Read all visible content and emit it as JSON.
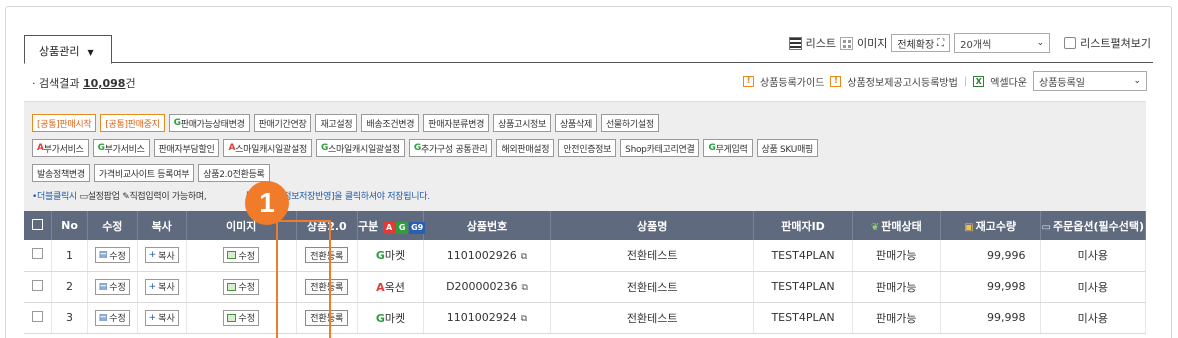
{
  "tab": {
    "label": "상품관리"
  },
  "view": {
    "list_label": "리스트",
    "image_label": "이미지",
    "expand_label": "전체확장",
    "per_page": "20개씩",
    "list_expand_label": "리스트펼쳐보기"
  },
  "result": {
    "prefix": "· 검색결과",
    "count": "10,098",
    "suffix": "건"
  },
  "guide": {
    "product_guide": "상품등록가이드",
    "info_guide": "상품정보제공고시등록방법",
    "excel_label": "엑셀다운",
    "sort_value": "상품등록일"
  },
  "buttons_row1": [
    "[공통]판매시작",
    "[공통]판매중지",
    "판매가능상태변경",
    "판매기간연장",
    "재고설정",
    "배송조건변경",
    "판매자분류변경",
    "상품고시정보",
    "상품삭제",
    "선물하기설정"
  ],
  "buttons_row2": [
    "부가서비스",
    "부가서비스",
    "판매자부담할인",
    "스마일캐시일괄설정",
    "스마일캐시일괄설정",
    "추가구성 공통관리",
    "해외판매설정",
    "안전인증정보",
    "Shop카테고리연결",
    "무게입력",
    "상품 SKU매핑"
  ],
  "row1_prefix": {
    "green_1": "G"
  },
  "row2_prefix": {
    "red_0": "A",
    "green_1": "G",
    "red_3": "A",
    "green_4": "G",
    "green_5": "G",
    "green_9": "G"
  },
  "buttons_row3": [
    "발송정책변경",
    "가격비교사이트 등록여부",
    "상품2.0전환등록"
  ],
  "note": {
    "part1": "•더블클릭시",
    "part2": "설정팝업",
    "part3": "직접입력이 가능하며,",
    "part4": "목은우측 [정보저장반영]을 클릭하셔야 저장됩니다."
  },
  "table": {
    "headers": {
      "no": "No",
      "edit": "수정",
      "copy": "복사",
      "image": "이미지",
      "product20": "상품2.0",
      "type": "구분",
      "product_no": "상품번호",
      "product_name": "상품명",
      "seller_id": "판매자ID",
      "sale_status": "판매상태",
      "stock": "재고수량",
      "order_option": "주문옵션(필수선택)"
    },
    "header_logos": {
      "a": "A",
      "g": "G",
      "g9": "G9"
    },
    "cell_labels": {
      "edit": "수정",
      "copy": "복사",
      "image": "수정",
      "register": "전환등록"
    },
    "rows": [
      {
        "no": "1",
        "type_mark": "G",
        "type_text": "마켓",
        "product_no": "1101002926",
        "product_name": "전환테스트",
        "seller_id": "TEST4PLAN",
        "status": "판매가능",
        "stock": "99,996",
        "option": "미사용"
      },
      {
        "no": "2",
        "type_mark": "A",
        "type_text": "옥션",
        "product_no": "D200000236",
        "product_name": "전환테스트",
        "seller_id": "TEST4PLAN",
        "status": "판매가능",
        "stock": "99,998",
        "option": "미사용"
      },
      {
        "no": "3",
        "type_mark": "G",
        "type_text": "마켓",
        "product_no": "1101002924",
        "product_name": "전환테스트",
        "seller_id": "TEST4PLAN",
        "status": "판매가능",
        "stock": "99,998",
        "option": "미사용"
      }
    ]
  },
  "callout": {
    "number": "1"
  },
  "colors": {
    "header_bg": "#5f6a7e",
    "highlight": "#f07c2b",
    "green_mark": "#2e9e3e",
    "red_mark": "#e53935",
    "note_blue": "#1e5aa8"
  }
}
